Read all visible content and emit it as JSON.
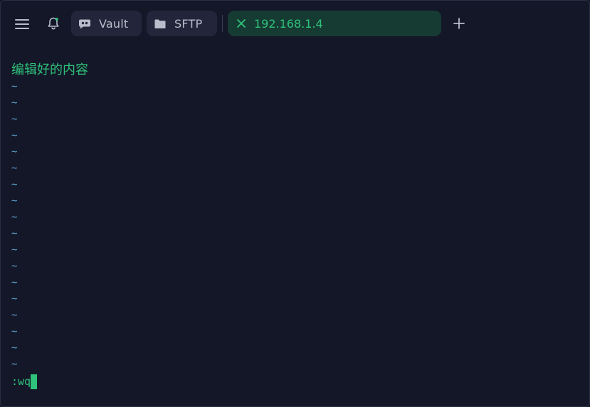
{
  "tabs": {
    "vault_label": "Vault",
    "sftp_label": "SFTP",
    "active_host": "192.168.1.4"
  },
  "terminal": {
    "content_line": "编辑好的内容",
    "tildes": [
      "~",
      "~",
      "~",
      "~",
      "~",
      "~",
      "~",
      "~",
      "~",
      "~",
      "~",
      "~",
      "~",
      "~",
      "~",
      "~",
      "~",
      "~"
    ],
    "command": ":wq"
  },
  "colors": {
    "background": "#141728",
    "accent": "#2fc27a",
    "tilde": "#5fa6d6",
    "pill": "#23263a",
    "active_tab": "#163b33"
  },
  "icons": {
    "menu": "hamburger-menu-icon",
    "notifications": "bell-icon",
    "vault": "vault-icon",
    "sftp": "folder-icon",
    "close_tab": "close-icon",
    "new_tab": "plus-icon"
  }
}
